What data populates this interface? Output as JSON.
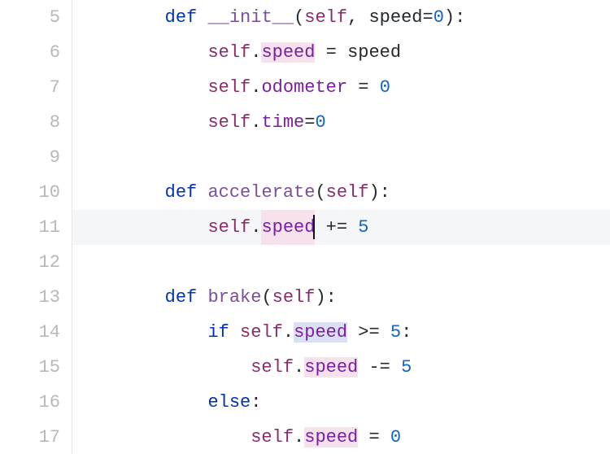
{
  "gutter": {
    "start": 5,
    "end": 17
  },
  "current_line_index": 6,
  "caret": {
    "line_index": 6,
    "after_token": "speed"
  },
  "code_lines": [
    {
      "n": 5,
      "indent": 2,
      "tokens": [
        {
          "t": "def ",
          "c": "kw"
        },
        {
          "t": "__init__",
          "c": "fn"
        },
        {
          "t": "(",
          "c": "pn"
        },
        {
          "t": "self",
          "c": "self"
        },
        {
          "t": ", ",
          "c": "pn"
        },
        {
          "t": "speed",
          "c": "pln"
        },
        {
          "t": "=",
          "c": "op"
        },
        {
          "t": "0",
          "c": "num"
        },
        {
          "t": "):",
          "c": "pn"
        }
      ]
    },
    {
      "n": 6,
      "indent": 3,
      "tokens": [
        {
          "t": "self",
          "c": "self"
        },
        {
          "t": ".",
          "c": "pn"
        },
        {
          "t": "speed",
          "c": "attr",
          "hl": "occ"
        },
        {
          "t": " = ",
          "c": "op"
        },
        {
          "t": "speed",
          "c": "pln"
        }
      ]
    },
    {
      "n": 7,
      "indent": 3,
      "tokens": [
        {
          "t": "self",
          "c": "self"
        },
        {
          "t": ".",
          "c": "pn"
        },
        {
          "t": "odometer",
          "c": "attr"
        },
        {
          "t": " = ",
          "c": "op"
        },
        {
          "t": "0",
          "c": "num"
        }
      ]
    },
    {
      "n": 8,
      "indent": 3,
      "tokens": [
        {
          "t": "self",
          "c": "self"
        },
        {
          "t": ".",
          "c": "pn"
        },
        {
          "t": "time",
          "c": "attr"
        },
        {
          "t": "=",
          "c": "op"
        },
        {
          "t": "0",
          "c": "num"
        }
      ]
    },
    {
      "n": 9,
      "indent": 0,
      "tokens": []
    },
    {
      "n": 10,
      "indent": 2,
      "tokens": [
        {
          "t": "def ",
          "c": "kw"
        },
        {
          "t": "accelerate",
          "c": "fn"
        },
        {
          "t": "(",
          "c": "pn"
        },
        {
          "t": "self",
          "c": "self"
        },
        {
          "t": "):",
          "c": "pn"
        }
      ]
    },
    {
      "n": 11,
      "indent": 3,
      "tokens": [
        {
          "t": "self",
          "c": "self"
        },
        {
          "t": ".",
          "c": "pn"
        },
        {
          "t": "speed",
          "c": "attr",
          "hl": "occ",
          "caret": true
        },
        {
          "t": " += ",
          "c": "op"
        },
        {
          "t": "5",
          "c": "num"
        }
      ]
    },
    {
      "n": 12,
      "indent": 0,
      "tokens": []
    },
    {
      "n": 13,
      "indent": 2,
      "tokens": [
        {
          "t": "def ",
          "c": "kw"
        },
        {
          "t": "brake",
          "c": "fn"
        },
        {
          "t": "(",
          "c": "pn"
        },
        {
          "t": "self",
          "c": "self"
        },
        {
          "t": "):",
          "c": "pn"
        }
      ]
    },
    {
      "n": 14,
      "indent": 3,
      "tokens": [
        {
          "t": "if ",
          "c": "kw"
        },
        {
          "t": "self",
          "c": "self"
        },
        {
          "t": ".",
          "c": "pn"
        },
        {
          "t": "speed",
          "c": "attr",
          "hl": "wrt"
        },
        {
          "t": " >= ",
          "c": "op"
        },
        {
          "t": "5",
          "c": "num"
        },
        {
          "t": ":",
          "c": "pn"
        }
      ]
    },
    {
      "n": 15,
      "indent": 4,
      "tokens": [
        {
          "t": "self",
          "c": "self"
        },
        {
          "t": ".",
          "c": "pn"
        },
        {
          "t": "speed",
          "c": "attr",
          "hl": "occ"
        },
        {
          "t": " -= ",
          "c": "op"
        },
        {
          "t": "5",
          "c": "num"
        }
      ]
    },
    {
      "n": 16,
      "indent": 3,
      "tokens": [
        {
          "t": "else",
          "c": "kw"
        },
        {
          "t": ":",
          "c": "pn"
        }
      ]
    },
    {
      "n": 17,
      "indent": 4,
      "tokens": [
        {
          "t": "self",
          "c": "self"
        },
        {
          "t": ".",
          "c": "pn"
        },
        {
          "t": "speed",
          "c": "attr",
          "hl": "occ"
        },
        {
          "t": " = ",
          "c": "op"
        },
        {
          "t": "0",
          "c": "num"
        }
      ]
    }
  ],
  "indent_unit": "    ",
  "colors": {
    "keyword": "#0033b3",
    "function": "#7a4f9a",
    "self": "#8a2b6c",
    "attribute": "#7b1fa2",
    "number": "#1565c0",
    "occurrence_bg": "#f5e2ed",
    "write_occurrence_bg": "#dbe1f5",
    "current_line_bg": "#f5f6f8",
    "gutter_fg": "#b8b8b8"
  }
}
